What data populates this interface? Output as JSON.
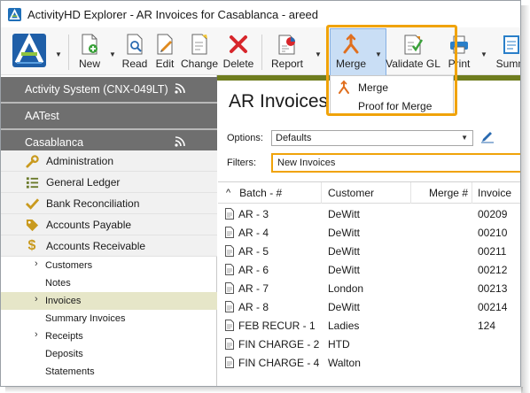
{
  "window": {
    "title": "ActivityHD Explorer - AR Invoices for Casablanca - areed"
  },
  "toolbar": {
    "buttons": [
      {
        "name": "new",
        "label": "New",
        "icon": "new-doc-icon"
      },
      {
        "name": "read",
        "label": "Read",
        "icon": "read-icon"
      },
      {
        "name": "edit",
        "label": "Edit",
        "icon": "edit-icon"
      },
      {
        "name": "change",
        "label": "Change",
        "icon": "change-icon"
      },
      {
        "name": "delete",
        "label": "Delete",
        "icon": "delete-icon"
      },
      {
        "name": "report",
        "label": "Report",
        "icon": "report-icon"
      },
      {
        "name": "merge",
        "label": "Merge",
        "icon": "merge-icon"
      },
      {
        "name": "validate-gl",
        "label": "Validate GL",
        "icon": "validate-gl-icon"
      },
      {
        "name": "print",
        "label": "Print",
        "icon": "print-icon"
      },
      {
        "name": "summary",
        "label": "Summ",
        "icon": "summary-icon"
      }
    ],
    "merge_menu": [
      "Merge",
      "Proof for Merge"
    ],
    "accent": "#f0a30a"
  },
  "nav": {
    "headers": [
      {
        "label": "Activity System (CNX-049LT)",
        "has_feed": true
      },
      {
        "label": "AATest",
        "has_feed": false
      },
      {
        "label": "Casablanca",
        "has_feed": true
      }
    ],
    "modules": [
      {
        "label": "Administration",
        "icon": "wrench-icon"
      },
      {
        "label": "General Ledger",
        "icon": "list-icon"
      },
      {
        "label": "Bank Reconciliation",
        "icon": "checkmark-icon"
      },
      {
        "label": "Accounts Payable",
        "icon": "tag-icon"
      },
      {
        "label": "Accounts Receivable",
        "icon": "dollar-icon"
      }
    ],
    "sub_items": [
      {
        "label": "Customers",
        "expandable": true
      },
      {
        "label": "Notes",
        "expandable": false
      },
      {
        "label": "Invoices",
        "expandable": true,
        "active": true
      },
      {
        "label": "Summary Invoices",
        "expandable": false
      },
      {
        "label": "Receipts",
        "expandable": true
      },
      {
        "label": "Deposits",
        "expandable": false
      },
      {
        "label": "Statements",
        "expandable": false
      }
    ],
    "header_color": "#6f6f6f",
    "active_color": "#e6e6c8",
    "olive": "#6f7d1f"
  },
  "main": {
    "title": "AR Invoices",
    "options_label": "Options:",
    "options_value": "Defaults",
    "filters_label": "Filters:",
    "filters_value": "New Invoices",
    "columns": [
      "Batch - #",
      "Customer",
      "Merge #",
      "Invoice"
    ],
    "rows": [
      {
        "batch": "AR - 3",
        "customer": "DeWitt",
        "merge": "",
        "invoice": "00209"
      },
      {
        "batch": "AR - 4",
        "customer": "DeWitt",
        "merge": "",
        "invoice": "00210"
      },
      {
        "batch": "AR - 5",
        "customer": "DeWitt",
        "merge": "",
        "invoice": "00211"
      },
      {
        "batch": "AR - 6",
        "customer": "DeWitt",
        "merge": "",
        "invoice": "00212"
      },
      {
        "batch": "AR - 7",
        "customer": "London",
        "merge": "",
        "invoice": "00213"
      },
      {
        "batch": "AR - 8",
        "customer": "DeWitt",
        "merge": "",
        "invoice": "00214"
      },
      {
        "batch": "FEB RECUR - 1",
        "customer": "Ladies",
        "merge": "",
        "invoice": "124"
      },
      {
        "batch": "FIN CHARGE - 2",
        "customer": "HTD",
        "merge": "",
        "invoice": ""
      },
      {
        "batch": "FIN CHARGE - 4",
        "customer": "Walton",
        "merge": "",
        "invoice": ""
      }
    ]
  }
}
